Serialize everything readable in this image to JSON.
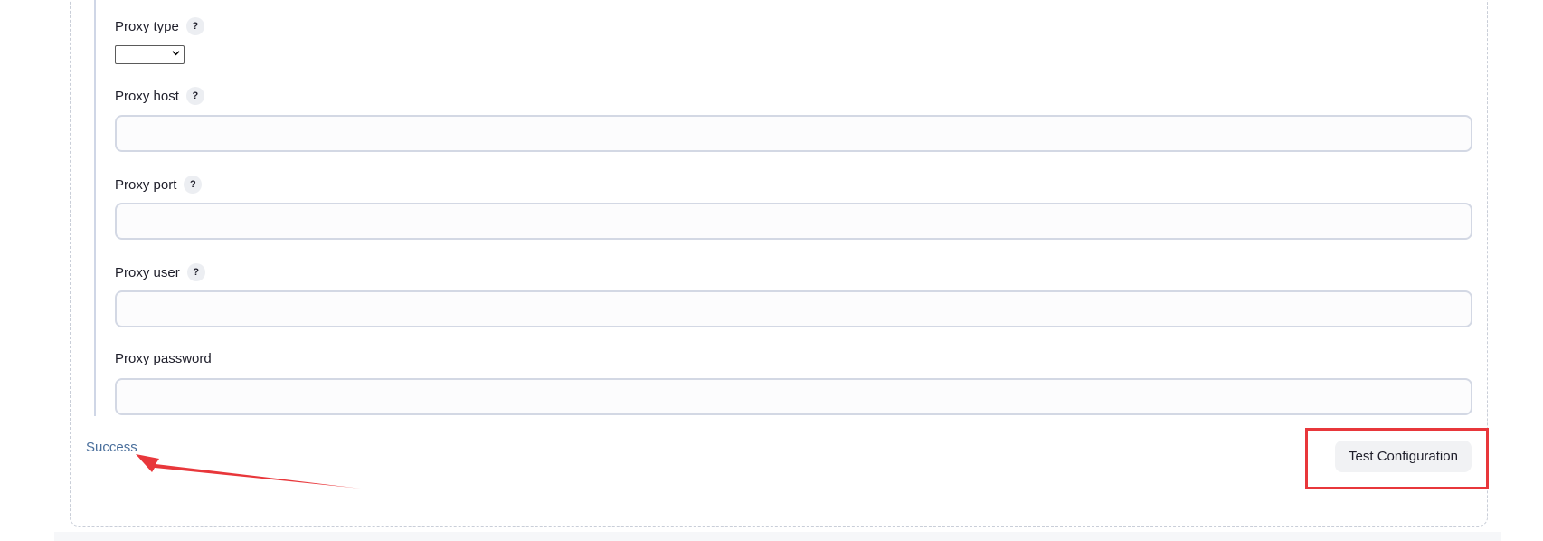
{
  "form": {
    "proxy_type": {
      "label": "Proxy type",
      "help": "?",
      "selected": ""
    },
    "proxy_host": {
      "label": "Proxy host",
      "help": "?",
      "value": ""
    },
    "proxy_port": {
      "label": "Proxy port",
      "help": "?",
      "value": ""
    },
    "proxy_user": {
      "label": "Proxy user",
      "help": "?",
      "value": ""
    },
    "proxy_password": {
      "label": "Proxy password",
      "value": ""
    }
  },
  "status": {
    "message": "Success"
  },
  "actions": {
    "test_label": "Test Configuration"
  },
  "annotation": {
    "color": "#e8373b"
  }
}
